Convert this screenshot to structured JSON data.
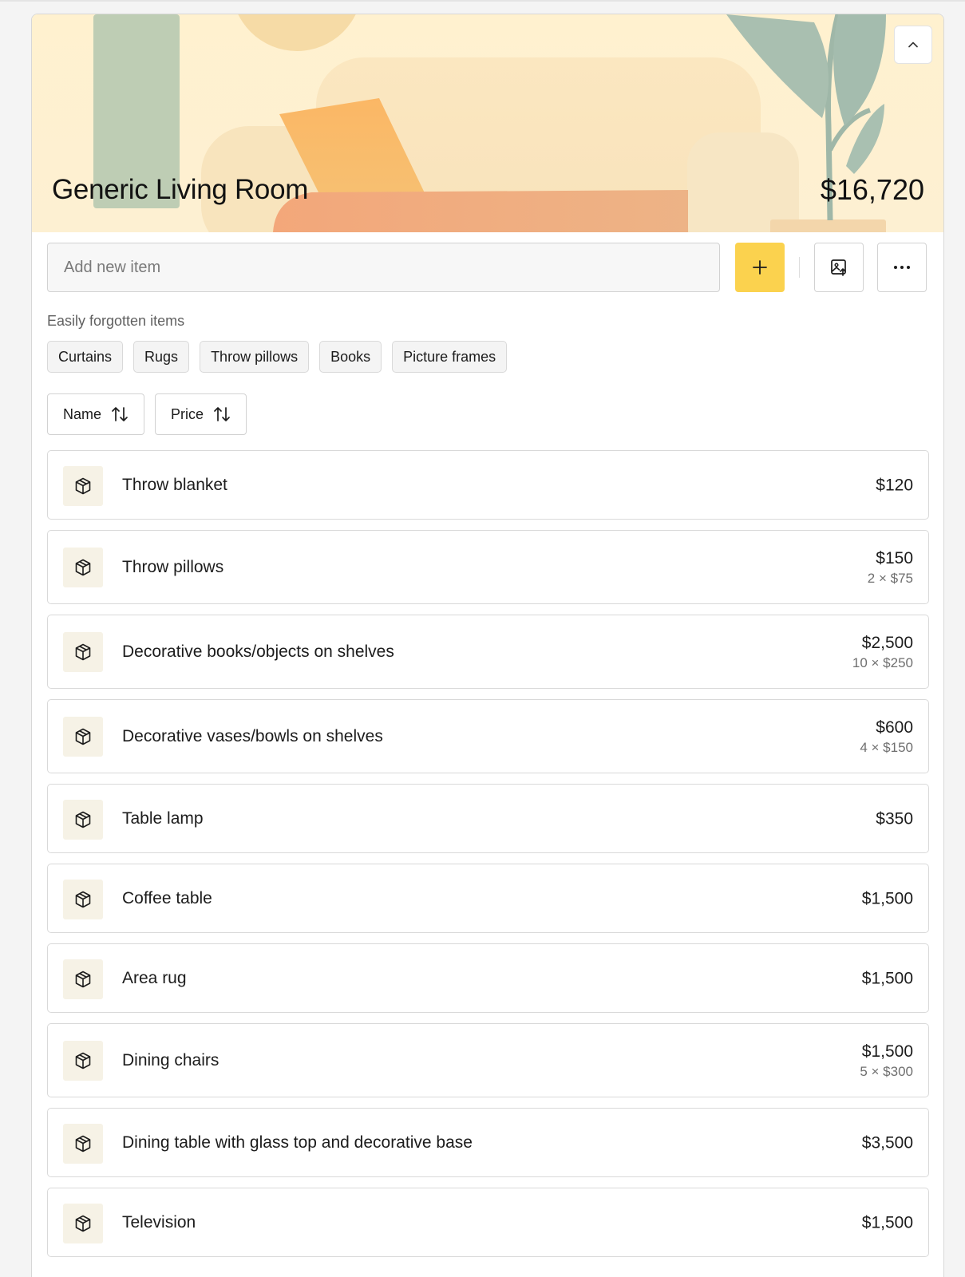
{
  "room": {
    "title": "Generic Living Room",
    "total": "$16,720"
  },
  "add_item": {
    "placeholder": "Add new item"
  },
  "actions": {
    "add_icon": "plus-icon",
    "upload_icon": "image-upload-icon",
    "more_icon": "more-horizontal-icon",
    "collapse_icon": "chevron-up-icon"
  },
  "forgotten": {
    "label": "Easily forgotten items",
    "chips": [
      "Curtains",
      "Rugs",
      "Throw pillows",
      "Books",
      "Picture frames"
    ]
  },
  "sort": {
    "name_label": "Name",
    "price_label": "Price"
  },
  "items": [
    {
      "name": "Throw blanket",
      "price": "$120",
      "qty": ""
    },
    {
      "name": "Throw pillows",
      "price": "$150",
      "qty": "2 × $75"
    },
    {
      "name": "Decorative books/objects on shelves",
      "price": "$2,500",
      "qty": "10 × $250"
    },
    {
      "name": "Decorative vases/bowls on shelves",
      "price": "$600",
      "qty": "4 × $150"
    },
    {
      "name": "Table lamp",
      "price": "$350",
      "qty": ""
    },
    {
      "name": "Coffee table",
      "price": "$1,500",
      "qty": ""
    },
    {
      "name": "Area rug",
      "price": "$1,500",
      "qty": ""
    },
    {
      "name": "Dining chairs",
      "price": "$1,500",
      "qty": "5 × $300"
    },
    {
      "name": "Dining table with glass top and decorative base",
      "price": "$3,500",
      "qty": ""
    },
    {
      "name": "Television",
      "price": "$1,500",
      "qty": ""
    }
  ],
  "colors": {
    "accent": "#fbd24e",
    "hero_bg": "#fff1cf",
    "item_icon_bg": "#f6f2e6"
  }
}
